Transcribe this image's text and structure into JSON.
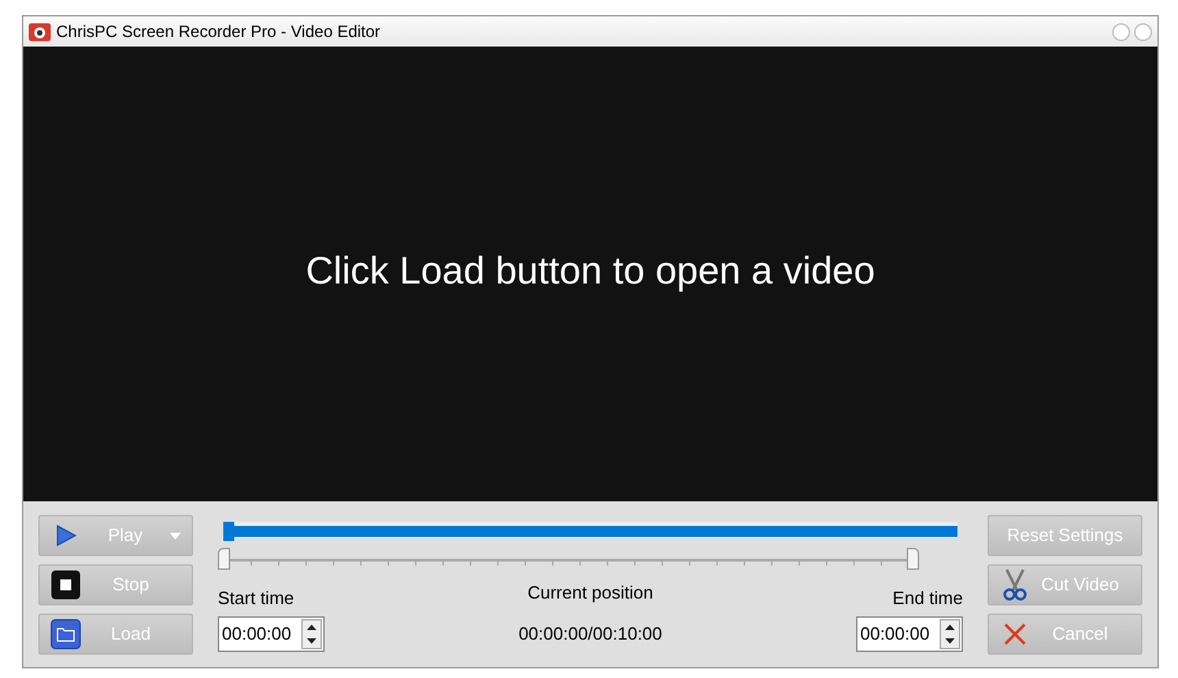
{
  "window": {
    "title": "ChrisPC Screen Recorder Pro - Video Editor"
  },
  "video": {
    "message": "Click Load button to open a video"
  },
  "left_buttons": [
    {
      "kind": "play",
      "label": "Play"
    },
    {
      "kind": "stop",
      "label": "Stop"
    },
    {
      "kind": "load",
      "label": "Load"
    }
  ],
  "progress": {
    "level": 1
  },
  "range": {
    "start_thumb": {
      "level": 0
    },
    "end_thumb": {
      "level": 1
    }
  },
  "start_time": {
    "label": "Start time",
    "value": "00:00:00"
  },
  "current_position": {
    "label": "Current position",
    "value": "00:00:00/00:10:00"
  },
  "end_time": {
    "label": "End time",
    "value": "00:00:00"
  },
  "right_buttons": [
    {
      "kind": "reset",
      "label": "Reset Settings"
    },
    {
      "kind": "cut",
      "label": "Cut Video"
    },
    {
      "kind": "cancel",
      "label": "Cancel"
    }
  ]
}
